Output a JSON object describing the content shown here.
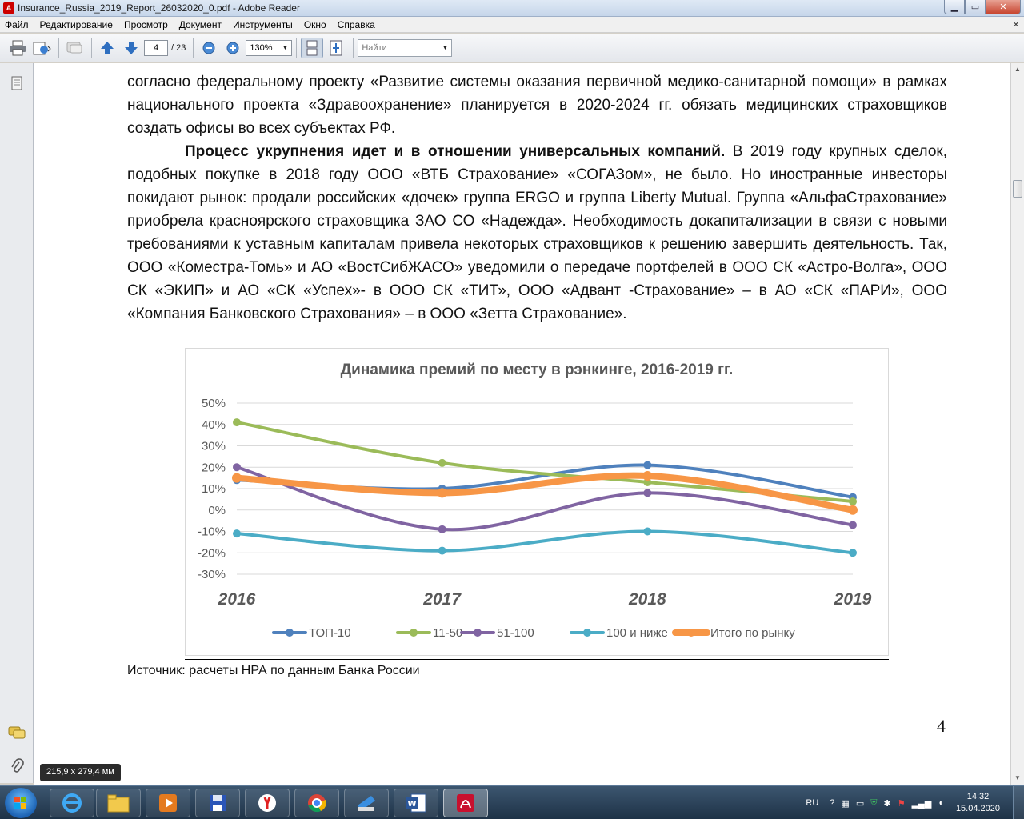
{
  "window": {
    "title": "Insurance_Russia_2019_Report_26032020_0.pdf - Adobe Reader",
    "min_label": "▁",
    "max_label": "▭",
    "close_label": "✕"
  },
  "menu": [
    "Файл",
    "Редактирование",
    "Просмотр",
    "Документ",
    "Инструменты",
    "Окно",
    "Справка"
  ],
  "toolbar": {
    "page_current": "4",
    "page_total": "/ 23",
    "zoom": "130%",
    "find_placeholder": "Найти"
  },
  "document": {
    "p1": "согласно федеральному проекту «Развитие системы оказания первичной медико-санитарной помощи» в рамках национального проекта «Здравоохранение» планируется в 2020-2024 гг. обязать медицинских страховщиков создать офисы во всех субъектах РФ.",
    "p2_bold": "Процесс укрупнения идет и в отношении универсальных компаний.",
    "p2_rest": " В 2019 году крупных сделок, подобных покупке в 2018 году ООО «ВТБ Страхование» «СОГАЗом», не было. Но иностранные инвесторы покидают рынок: продали российских «дочек» группа ERGO и группа Liberty Mutual. Группа «АльфаСтрахование» приобрела красноярского страховщика ЗАО СО «Надежда». Необходимость докапитализации в связи с новыми требованиями к уставным капиталам привела некоторых страховщиков к решению завершить деятельность. Так, ООО «Коместра-Томь» и АО «ВостСибЖАСО» уведомили о передаче портфелей в ООО СК «Астро-Волга», ООО СК «ЭКИП» и АО «СК «Успех»- в ООО СК «ТИТ», ООО «Адвант -Страхование» – в АО «СК «ПАРИ», ООО «Компания Банковского Страхования» – в ООО «Зетта Страхование».",
    "source": "Источник: расчеты НРА по данным Банка России",
    "page_number": "4",
    "page_size": "215,9 x 279,4 мм"
  },
  "chart_data": {
    "type": "line",
    "title": "Динамика премий по месту в рэнкинге, 2016-2019 гг.",
    "categories": [
      "2016",
      "2017",
      "2018",
      "2019"
    ],
    "y_ticks": [
      "50%",
      "40%",
      "30%",
      "20%",
      "10%",
      "0%",
      "-10%",
      "-20%",
      "-30%"
    ],
    "ylim": [
      -30,
      50
    ],
    "grid": true,
    "legend_position": "bottom",
    "series": [
      {
        "name": "ТОП-10",
        "color": "#4f81bd",
        "values": [
          14,
          10,
          21,
          6
        ]
      },
      {
        "name": "11-50",
        "color": "#9bbb59",
        "values": [
          41,
          22,
          13,
          4
        ]
      },
      {
        "name": "51-100",
        "color": "#8064a2",
        "values": [
          20,
          -9,
          8,
          -7
        ]
      },
      {
        "name": "100 и ниже",
        "color": "#4bacc6",
        "values": [
          -11,
          -19,
          -10,
          -20
        ]
      },
      {
        "name": "Итого по рынку",
        "color": "#f79646",
        "values": [
          15,
          8,
          16,
          0
        ]
      }
    ]
  },
  "tray": {
    "lang": "RU",
    "time": "14:32",
    "date": "15.04.2020"
  }
}
